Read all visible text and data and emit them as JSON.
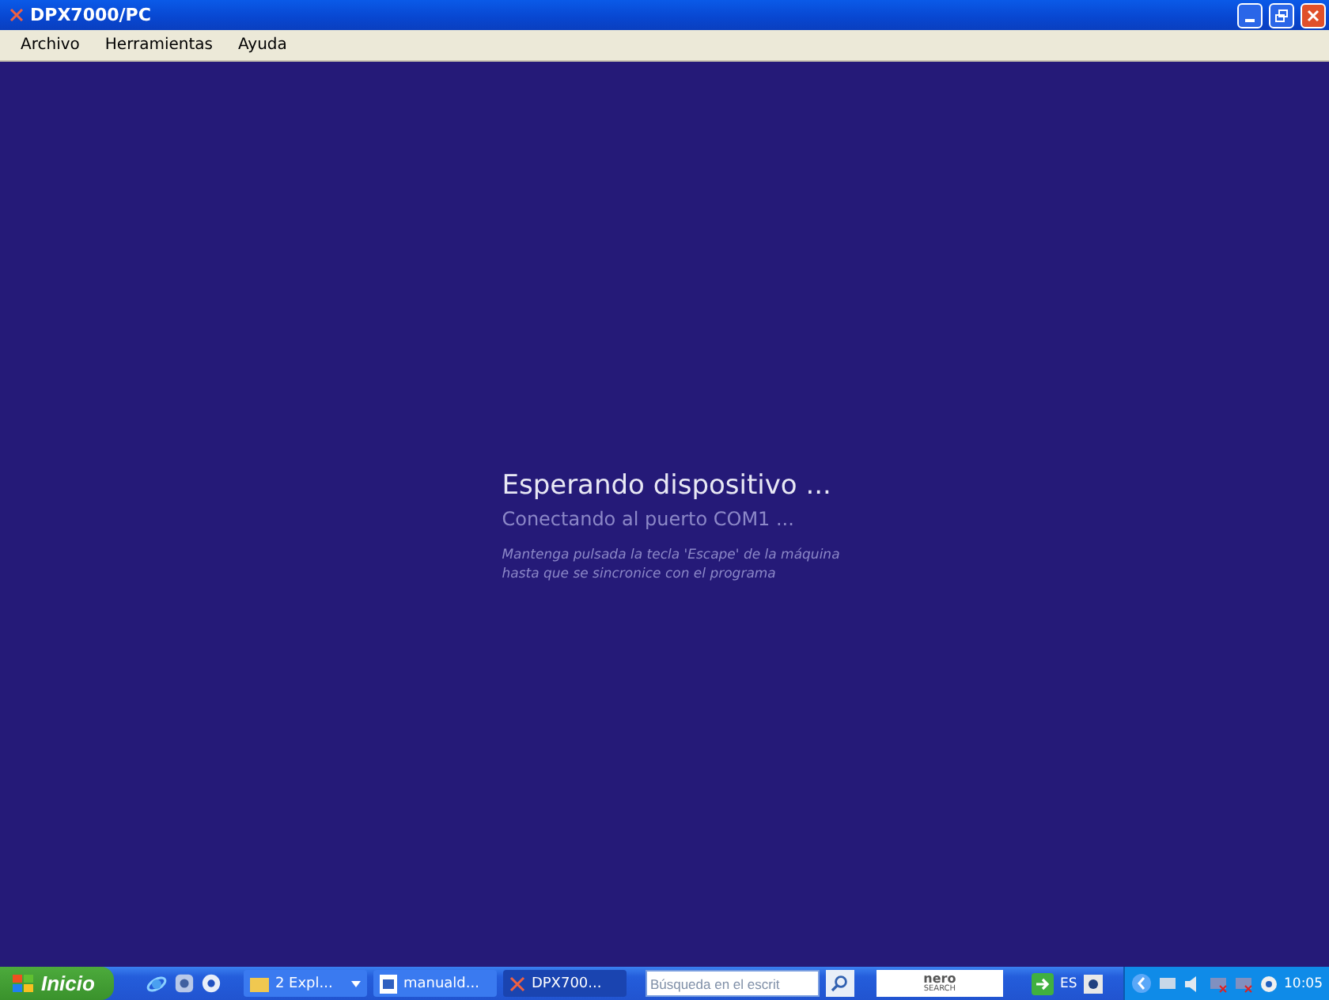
{
  "window": {
    "title": "DPX7000/PC"
  },
  "menu": [
    {
      "label": "Archivo"
    },
    {
      "label": "Herramientas"
    },
    {
      "label": "Ayuda"
    }
  ],
  "status": {
    "heading": "Esperando dispositivo ...",
    "subtitle": "Conectando al puerto COM1 ...",
    "hint_lines": [
      "Mantenga pulsada la tecla 'Escape' de la máquina",
      "hasta que se sincronice con el programa"
    ]
  },
  "taskbar": {
    "start": "Inicio",
    "tasks": [
      {
        "label": "2 Expl...",
        "kind": "group",
        "selected": false
      },
      {
        "label": "manuald...",
        "kind": "document",
        "selected": false
      },
      {
        "label": "DPX700...",
        "kind": "app",
        "selected": true
      }
    ],
    "search": {
      "placeholder": "Búsqueda en el escrit"
    },
    "nero": {
      "brand": "nero",
      "sub": "SEARCH"
    },
    "language": "ES",
    "clock": "10:05"
  }
}
